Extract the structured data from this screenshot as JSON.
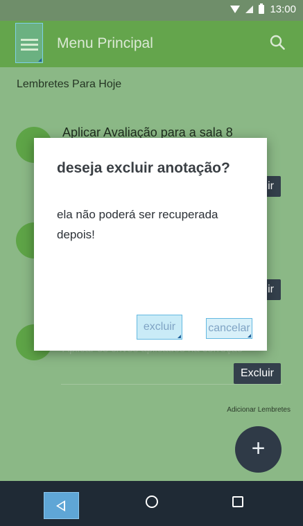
{
  "status_bar": {
    "time": "13:00"
  },
  "app_bar": {
    "title": "Menu Principal",
    "menu_icon": "hamburger-menu-icon",
    "search_icon": "search-icon"
  },
  "content": {
    "section_title": "Lembretes Para Hoje",
    "reminders": [
      {
        "title": "Aplicar Avaliação para a sala 8",
        "description": "",
        "delete_label": "Excluir"
      },
      {
        "title": "",
        "description": "",
        "delete_label": "Excluir"
      },
      {
        "title": "",
        "description": "Aplicar os crivos aplicados na correção",
        "delete_label": "Excluir"
      }
    ],
    "add_label": "Adicionar Lembretes",
    "fab_label": "+"
  },
  "dialog": {
    "title": "deseja excluir anotação?",
    "message": "ela não poderá ser recuperada depois!",
    "confirm_label": "excluir",
    "cancel_label": "cancelar"
  },
  "nav_bar": {
    "back_icon": "back-icon",
    "home_icon": "home-icon",
    "recent_icon": "recent-apps-icon"
  },
  "colors": {
    "app_bar": "#64a54c",
    "content_bg": "#8bb886",
    "avatar": "#5ea447",
    "dark_button": "#34404c",
    "fab": "#2f3a47",
    "nav_bar": "#1f2a35"
  }
}
